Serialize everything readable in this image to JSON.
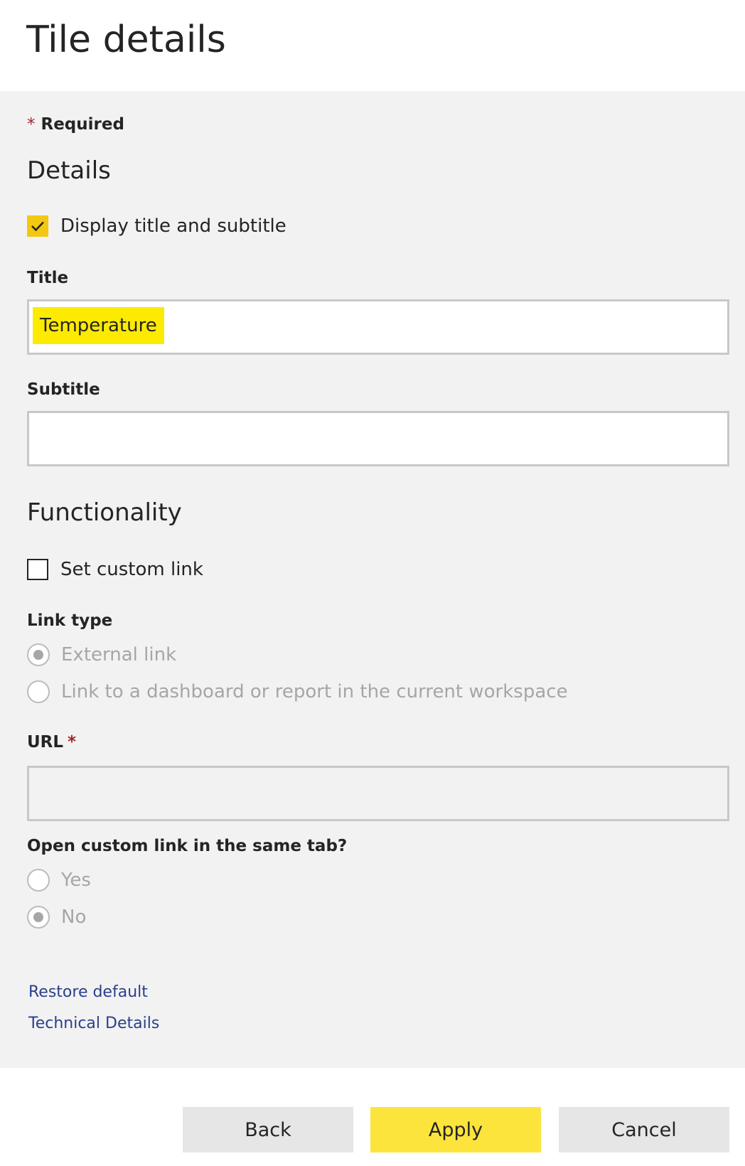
{
  "header": {
    "title": "Tile details"
  },
  "form": {
    "required_star": "*",
    "required_label": "Required",
    "details_heading": "Details",
    "display_title_subtitle": {
      "label": "Display title and subtitle",
      "checked": true
    },
    "title_field": {
      "label": "Title",
      "value": "Temperature"
    },
    "subtitle_field": {
      "label": "Subtitle",
      "value": ""
    },
    "functionality_heading": "Functionality",
    "set_custom_link": {
      "label": "Set custom link",
      "checked": false
    },
    "link_type": {
      "label": "Link type",
      "options": [
        {
          "label": "External link",
          "selected": true,
          "disabled": true
        },
        {
          "label": "Link to a dashboard or report in the current workspace",
          "selected": false,
          "disabled": true
        }
      ]
    },
    "url_field": {
      "label": "URL",
      "required_star": "*",
      "value": "",
      "disabled": true
    },
    "same_tab": {
      "label": "Open custom link in the same tab?",
      "options": [
        {
          "label": "Yes",
          "selected": false,
          "disabled": true
        },
        {
          "label": "No",
          "selected": true,
          "disabled": true
        }
      ]
    },
    "links": {
      "restore_default": "Restore default",
      "technical_details": "Technical Details"
    }
  },
  "footer": {
    "back_label": "Back",
    "apply_label": "Apply",
    "cancel_label": "Cancel"
  },
  "colors": {
    "accent_yellow": "#f2c811",
    "apply_button": "#fce43d",
    "highlight": "#fcea00",
    "panel_background": "#f2f2f2",
    "link": "#2b3f8c",
    "required_star": "#a4262c",
    "disabled_text": "#a6a6a6"
  },
  "icons": {
    "checkmark": "checkmark-icon"
  }
}
